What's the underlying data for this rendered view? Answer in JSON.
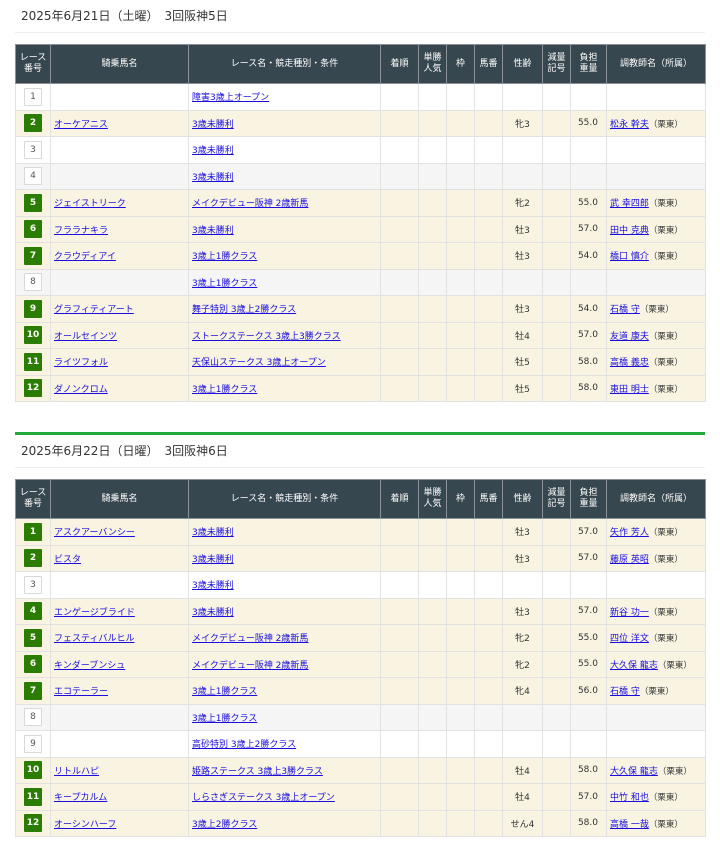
{
  "headers": {
    "race_no": [
      "レース",
      "番号"
    ],
    "horse": "騎乗馬名",
    "race": "レース名・競走種別・条件",
    "finish": "着順",
    "pop": [
      "単勝",
      "人気"
    ],
    "waku": "枠",
    "umaban": "馬番",
    "sexage": "性齢",
    "reduce": [
      "減量",
      "記号"
    ],
    "weight": [
      "負担",
      "重量"
    ],
    "trainer": "調教師名（所属）"
  },
  "days": [
    {
      "title": "2025年6月21日（土曜）　3回阪神5日",
      "races": [
        {
          "no": "1",
          "horse": "",
          "race": "障害3歳上オープン",
          "sexage": "",
          "weight": "",
          "trainer": "",
          "aff": ""
        },
        {
          "no": "2",
          "horse": "オーケアニス",
          "race": "3歳未勝利",
          "sexage": "牝3",
          "weight": "55.0",
          "trainer": "松永 幹夫",
          "aff": "（栗東）"
        },
        {
          "no": "3",
          "horse": "",
          "race": "3歳未勝利",
          "sexage": "",
          "weight": "",
          "trainer": "",
          "aff": ""
        },
        {
          "no": "4",
          "horse": "",
          "race": "3歳未勝利",
          "sexage": "",
          "weight": "",
          "trainer": "",
          "aff": ""
        },
        {
          "no": "5",
          "horse": "ジェイストリーク",
          "race": "メイクデビュー阪神 2歳新馬",
          "sexage": "牝2",
          "weight": "55.0",
          "trainer": "武 幸四郎",
          "aff": "（栗東）"
        },
        {
          "no": "6",
          "horse": "フララナキラ",
          "race": "3歳未勝利",
          "sexage": "牡3",
          "weight": "57.0",
          "trainer": "田中 克典",
          "aff": "（栗東）"
        },
        {
          "no": "7",
          "horse": "クラウディアイ",
          "race": "3歳上1勝クラス",
          "sexage": "牡3",
          "weight": "54.0",
          "trainer": "橋口 慎介",
          "aff": "（栗東）"
        },
        {
          "no": "8",
          "horse": "",
          "race": "3歳上1勝クラス",
          "sexage": "",
          "weight": "",
          "trainer": "",
          "aff": ""
        },
        {
          "no": "9",
          "horse": "グラフィティアート",
          "race": "舞子特別 3歳上2勝クラス",
          "sexage": "牡3",
          "weight": "54.0",
          "trainer": "石橋 守",
          "aff": "（栗東）"
        },
        {
          "no": "10",
          "horse": "オールセインツ",
          "race": "ストークステークス 3歳上3勝クラス",
          "sexage": "牡4",
          "weight": "57.0",
          "trainer": "友道 康夫",
          "aff": "（栗東）"
        },
        {
          "no": "11",
          "horse": "ライツフォル",
          "race": "天保山ステークス 3歳上オープン",
          "sexage": "牡5",
          "weight": "58.0",
          "trainer": "高橋 義忠",
          "aff": "（栗東）"
        },
        {
          "no": "12",
          "horse": "ダノンクロム",
          "race": "3歳上1勝クラス",
          "sexage": "牡5",
          "weight": "58.0",
          "trainer": "東田 明士",
          "aff": "（栗東）"
        }
      ]
    },
    {
      "title": "2025年6月22日（日曜）　3回阪神6日",
      "races": [
        {
          "no": "1",
          "horse": "アスクアーバンシー",
          "race": "3歳未勝利",
          "sexage": "牡3",
          "weight": "57.0",
          "trainer": "矢作 芳人",
          "aff": "（栗東）"
        },
        {
          "no": "2",
          "horse": "ビスタ",
          "race": "3歳未勝利",
          "sexage": "牡3",
          "weight": "57.0",
          "trainer": "藤原 英昭",
          "aff": "（栗東）"
        },
        {
          "no": "3",
          "horse": "",
          "race": "3歳未勝利",
          "sexage": "",
          "weight": "",
          "trainer": "",
          "aff": ""
        },
        {
          "no": "4",
          "horse": "エンゲージブライド",
          "race": "3歳未勝利",
          "sexage": "牡3",
          "weight": "57.0",
          "trainer": "新谷 功一",
          "aff": "（栗東）"
        },
        {
          "no": "5",
          "horse": "フェスティバルヒル",
          "race": "メイクデビュー阪神 2歳新馬",
          "sexage": "牝2",
          "weight": "55.0",
          "trainer": "四位 洋文",
          "aff": "（栗東）"
        },
        {
          "no": "6",
          "horse": "キンダーブンシュ",
          "race": "メイクデビュー阪神 2歳新馬",
          "sexage": "牝2",
          "weight": "55.0",
          "trainer": "大久保 龍志",
          "aff": "（栗東）"
        },
        {
          "no": "7",
          "horse": "エコテーラー",
          "race": "3歳上1勝クラス",
          "sexage": "牝4",
          "weight": "56.0",
          "trainer": "石橋 守",
          "aff": "（栗東）"
        },
        {
          "no": "8",
          "horse": "",
          "race": "3歳上1勝クラス",
          "sexage": "",
          "weight": "",
          "trainer": "",
          "aff": ""
        },
        {
          "no": "9",
          "horse": "",
          "race": "高砂特別 3歳上2勝クラス",
          "sexage": "",
          "weight": "",
          "trainer": "",
          "aff": ""
        },
        {
          "no": "10",
          "horse": "リトルハピ",
          "race": "姫路ステークス 3歳上3勝クラス",
          "sexage": "牡4",
          "weight": "58.0",
          "trainer": "大久保 龍志",
          "aff": "（栗東）"
        },
        {
          "no": "11",
          "horse": "キープカルム",
          "race": "しらさぎステークス 3歳上オープン",
          "sexage": "牡4",
          "weight": "57.0",
          "trainer": "中竹 和也",
          "aff": "（栗東）"
        },
        {
          "no": "12",
          "horse": "オーシンハーフ",
          "race": "3歳上2勝クラス",
          "sexage": "せん4",
          "weight": "58.0",
          "trainer": "高橋 一哉",
          "aff": "（栗東）"
        }
      ]
    }
  ]
}
